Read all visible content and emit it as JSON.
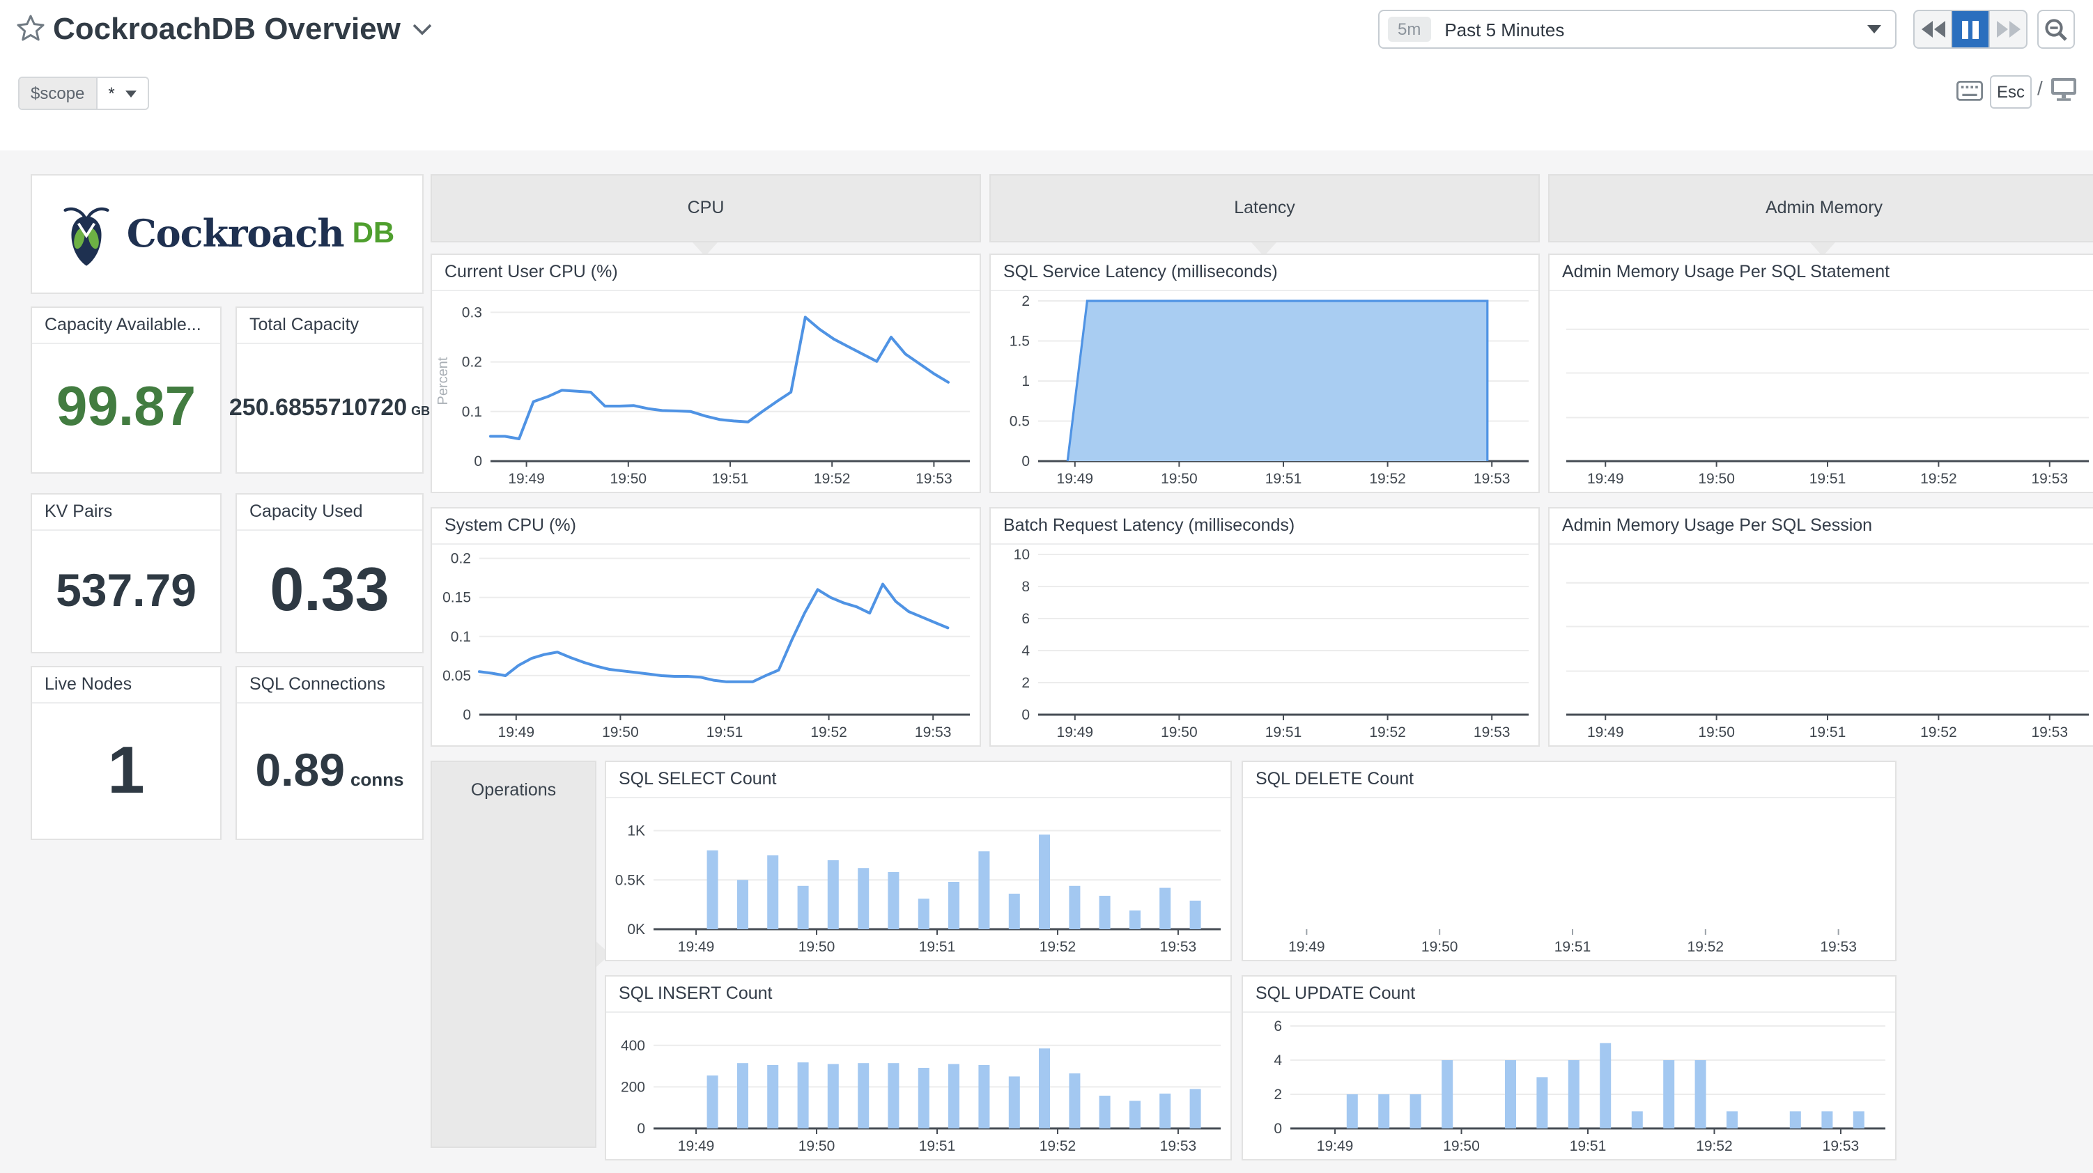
{
  "header": {
    "title": "CockroachDB Overview",
    "time_badge": "5m",
    "time_label": "Past 5 Minutes",
    "esc_label": "Esc",
    "slash": "/"
  },
  "scope": {
    "label": "$scope",
    "value": "*"
  },
  "logo": {
    "brand": "Cockroach",
    "suffix": "DB"
  },
  "stats": [
    {
      "label": "Capacity Available...",
      "value": "99.87",
      "unit": ""
    },
    {
      "label": "Total Capacity",
      "value": "250.6855710720",
      "unit": "GB"
    },
    {
      "label": "KV Pairs",
      "value": "537.79",
      "unit": ""
    },
    {
      "label": "Capacity Used",
      "value": "0.33",
      "unit": ""
    },
    {
      "label": "Live Nodes",
      "value": "1",
      "unit": ""
    },
    {
      "label": "SQL Connections",
      "value": "0.89",
      "unit": "conns"
    }
  ],
  "groups": {
    "cpu": "CPU",
    "latency": "Latency",
    "admin": "Admin Memory",
    "operations": "Operations"
  },
  "colors": {
    "accent_blue": "#2b6fbe",
    "chart_line": "#4f93e4",
    "chart_fill": "#a9cdf2",
    "chart_bar": "#a3c8f1",
    "stat_green": "#427c40",
    "brand_navy": "#1e3050",
    "brand_green": "#4f9f2e"
  },
  "chart_data": {
    "cpu_user": {
      "type": "line",
      "title": "Current User CPU (%)",
      "ylabel": "Percent",
      "ylim": [
        0,
        0.323
      ],
      "baseline": true,
      "yticks": [
        {
          "v": 0,
          "label": "0"
        },
        {
          "v": 0.1,
          "label": "0.1"
        },
        {
          "v": 0.2,
          "label": "0.2"
        },
        {
          "v": 0.3,
          "label": "0.3"
        }
      ],
      "xticks": [
        "19:49",
        "19:50",
        "19:51",
        "19:52",
        "19:53"
      ],
      "x_span": [
        0,
        0.955
      ],
      "color": "#4f93e4",
      "values": [
        0.05,
        0.05,
        0.045,
        0.12,
        0.13,
        0.143,
        0.141,
        0.139,
        0.111,
        0.111,
        0.112,
        0.106,
        0.102,
        0.101,
        0.1,
        0.091,
        0.084,
        0.081,
        0.079,
        0.1,
        0.12,
        0.139,
        0.29,
        0.266,
        0.246,
        0.231,
        0.216,
        0.201,
        0.25,
        0.216,
        0.196,
        0.176,
        0.159
      ]
    },
    "cpu_system": {
      "type": "line",
      "title": "System CPU (%)",
      "ylim": [
        0,
        0.205
      ],
      "baseline": true,
      "yticks": [
        {
          "v": 0,
          "label": "0"
        },
        {
          "v": 0.05,
          "label": "0.05"
        },
        {
          "v": 0.1,
          "label": "0.1"
        },
        {
          "v": 0.15,
          "label": "0.15"
        },
        {
          "v": 0.2,
          "label": "0.2"
        }
      ],
      "xticks": [
        "19:49",
        "19:50",
        "19:51",
        "19:52",
        "19:53"
      ],
      "x_span": [
        0,
        0.955
      ],
      "color": "#4f93e4",
      "values": [
        0.055,
        0.053,
        0.05,
        0.063,
        0.072,
        0.077,
        0.08,
        0.073,
        0.067,
        0.062,
        0.058,
        0.056,
        0.054,
        0.052,
        0.05,
        0.049,
        0.049,
        0.048,
        0.044,
        0.042,
        0.042,
        0.042,
        0.05,
        0.057,
        0.095,
        0.13,
        0.16,
        0.15,
        0.143,
        0.138,
        0.13,
        0.167,
        0.145,
        0.132,
        0.125,
        0.118,
        0.111
      ]
    },
    "sql_service_latency": {
      "type": "area",
      "title": "SQL Service Latency (milliseconds)",
      "ylim": [
        0,
        2
      ],
      "baseline": true,
      "yticks": [
        {
          "v": 0,
          "label": "0"
        },
        {
          "v": 0.5,
          "label": "0.5"
        },
        {
          "v": 1,
          "label": "1"
        },
        {
          "v": 1.5,
          "label": "1.5"
        },
        {
          "v": 2,
          "label": "2"
        }
      ],
      "xticks": [
        "19:49",
        "19:50",
        "19:51",
        "19:52",
        "19:53"
      ],
      "color": "#4f93e4",
      "fill": "#a9cdf2",
      "points": [
        [
          0.06,
          0
        ],
        [
          0.1,
          2
        ],
        [
          0.916,
          2
        ],
        [
          0.916,
          0
        ]
      ]
    },
    "batch_request_latency": {
      "type": "empty",
      "title": "Batch Request Latency (milliseconds)",
      "ylim": [
        0,
        10
      ],
      "baseline": true,
      "yticks": [
        {
          "v": 0,
          "label": "0"
        },
        {
          "v": 2,
          "label": "2"
        },
        {
          "v": 4,
          "label": "4"
        },
        {
          "v": 6,
          "label": "6"
        },
        {
          "v": 8,
          "label": "8"
        },
        {
          "v": 10,
          "label": "10"
        }
      ],
      "xticks": [
        "19:49",
        "19:50",
        "19:51",
        "19:52",
        "19:53"
      ]
    },
    "admin_mem_statement": {
      "type": "empty",
      "title": "Admin Memory Usage Per SQL Statement",
      "ylim": [
        0,
        1
      ],
      "baseline": true,
      "yticks": [
        {
          "v": 0.272,
          "label": ""
        },
        {
          "v": 0.55,
          "label": ""
        },
        {
          "v": 0.823,
          "label": ""
        }
      ],
      "xticks": [
        "19:49",
        "19:50",
        "19:51",
        "19:52",
        "19:53"
      ]
    },
    "admin_mem_session": {
      "type": "empty",
      "title": "Admin Memory Usage Per SQL Session",
      "ylim": [
        0,
        1
      ],
      "baseline": true,
      "yticks": [
        {
          "v": 0.272,
          "label": ""
        },
        {
          "v": 0.55,
          "label": ""
        },
        {
          "v": 0.823,
          "label": ""
        }
      ],
      "xticks": [
        "19:49",
        "19:50",
        "19:51",
        "19:52",
        "19:53"
      ]
    },
    "sql_select": {
      "type": "bar",
      "title": "SQL SELECT Count",
      "ylim": [
        0,
        1230
      ],
      "baseline": true,
      "yticks": [
        {
          "v": 0,
          "label": "0K"
        },
        {
          "v": 500,
          "label": "0.5K"
        },
        {
          "v": 1000,
          "label": "1K"
        }
      ],
      "xticks": [
        "19:49",
        "19:50",
        "19:51",
        "19:52",
        "19:53"
      ],
      "color": "#a3c8f1",
      "bar": {
        "x0": 0.104,
        "dx": 0.0532,
        "w": 8
      },
      "values": [
        800,
        500,
        750,
        440,
        700,
        620,
        580,
        310,
        480,
        790,
        360,
        960,
        440,
        340,
        190,
        420,
        290
      ]
    },
    "sql_delete": {
      "type": "empty",
      "title": "SQL DELETE Count",
      "ylim": [
        0,
        1
      ],
      "baseline": false,
      "yticks": [],
      "xticks": [
        "19:49",
        "19:50",
        "19:51",
        "19:52",
        "19:53"
      ]
    },
    "sql_insert": {
      "type": "bar",
      "title": "SQL INSERT Count",
      "ylim": [
        0,
        510
      ],
      "baseline": true,
      "yticks": [
        {
          "v": 0,
          "label": "0"
        },
        {
          "v": 200,
          "label": "200"
        },
        {
          "v": 400,
          "label": "400"
        }
      ],
      "xticks": [
        "19:49",
        "19:50",
        "19:51",
        "19:52",
        "19:53"
      ],
      "color": "#a3c8f1",
      "bar": {
        "x0": 0.104,
        "dx": 0.0532,
        "w": 8
      },
      "values": [
        255,
        315,
        305,
        318,
        310,
        315,
        315,
        292,
        310,
        305,
        250,
        385,
        265,
        158,
        133,
        168,
        190
      ]
    },
    "sql_update": {
      "type": "bar",
      "title": "SQL UPDATE Count",
      "ylim": [
        0,
        6.2
      ],
      "baseline": true,
      "yticks": [
        {
          "v": 0,
          "label": "0"
        },
        {
          "v": 2,
          "label": "2"
        },
        {
          "v": 4,
          "label": "4"
        },
        {
          "v": 6,
          "label": "6"
        }
      ],
      "xticks": [
        "19:49",
        "19:50",
        "19:51",
        "19:52",
        "19:53"
      ],
      "color": "#a3c8f1",
      "bar": {
        "x0": 0.104,
        "dx": 0.0532,
        "w": 8
      },
      "values": [
        2,
        2,
        2,
        4,
        0,
        4,
        3,
        4,
        5,
        1,
        4,
        4,
        1,
        0,
        1,
        1,
        1
      ]
    }
  }
}
